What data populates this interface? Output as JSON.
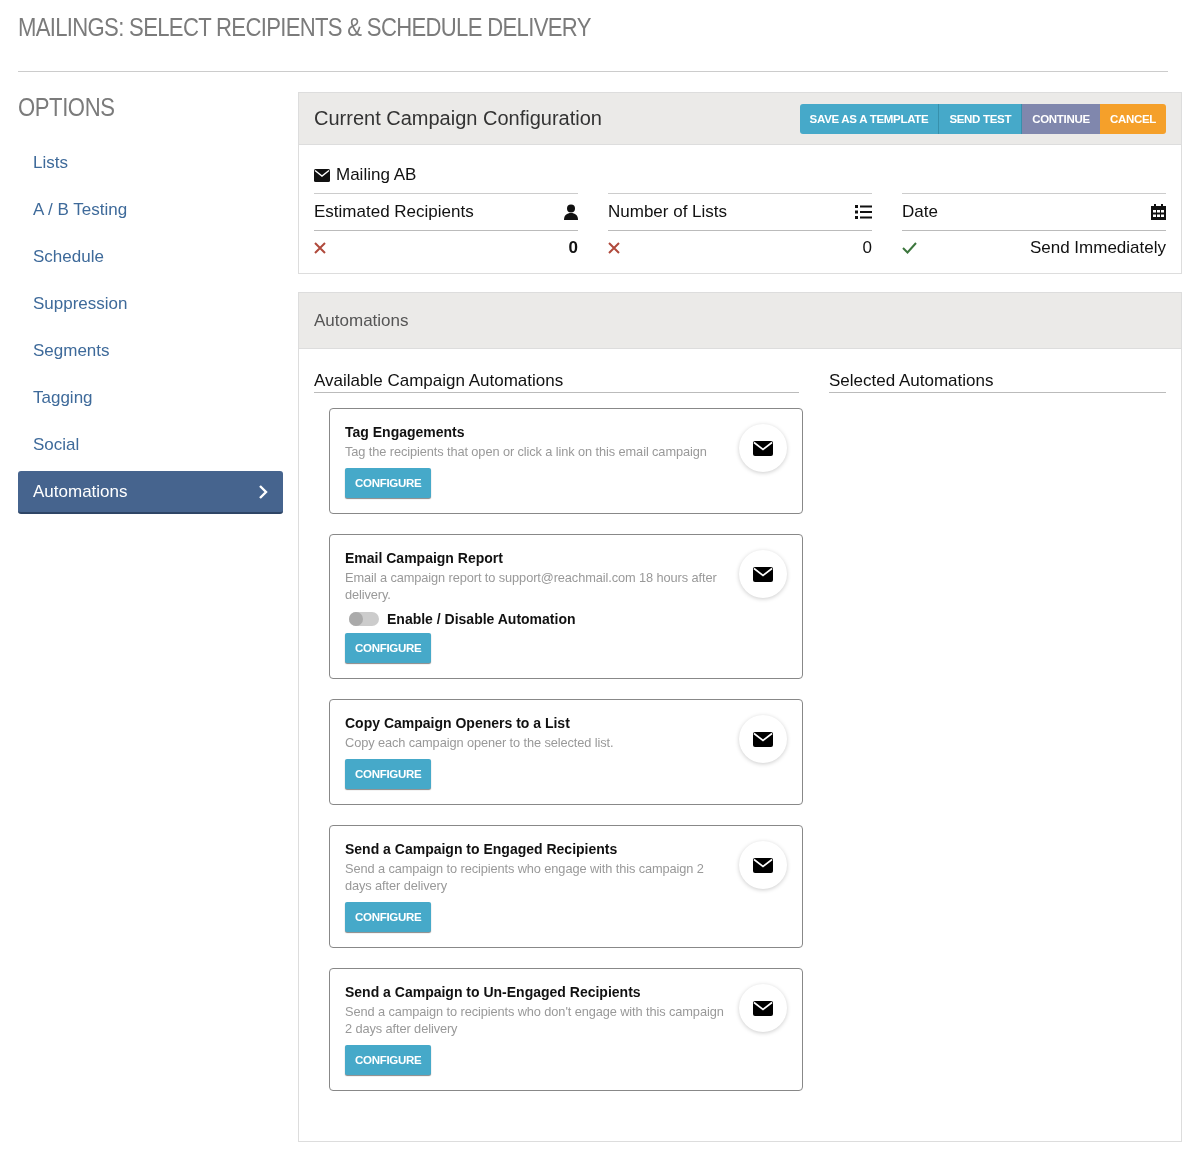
{
  "page_title": "MAILINGS: SELECT RECIPIENTS & SCHEDULE DELIVERY",
  "sidebar": {
    "title": "OPTIONS",
    "items": [
      {
        "label": "Lists",
        "selected": false
      },
      {
        "label": "A / B Testing",
        "selected": false
      },
      {
        "label": "Schedule",
        "selected": false
      },
      {
        "label": "Suppression",
        "selected": false
      },
      {
        "label": "Segments",
        "selected": false
      },
      {
        "label": "Tagging",
        "selected": false
      },
      {
        "label": "Social",
        "selected": false
      },
      {
        "label": "Automations",
        "selected": true
      }
    ]
  },
  "config": {
    "title": "Current Campaign Configuration",
    "buttons": [
      {
        "label": "SAVE AS A TEMPLATE",
        "kind": "info"
      },
      {
        "label": "SEND TEST",
        "kind": "info"
      },
      {
        "label": "CONTINUE",
        "kind": "muted"
      },
      {
        "label": "CANCEL",
        "kind": "warning"
      }
    ],
    "mailing_name": "Mailing AB",
    "stats": [
      {
        "label": "Estimated Recipients",
        "kind": "person",
        "ok": false,
        "value": "0",
        "bold": true
      },
      {
        "label": "Number of Lists",
        "kind": "list",
        "ok": false,
        "value": "0",
        "bold": false
      },
      {
        "label": "Date",
        "kind": "calendar",
        "ok": true,
        "value": "Send Immediately",
        "bold": false
      }
    ]
  },
  "automations": {
    "title": "Automations",
    "available_heading": "Available Campaign Automations",
    "selected_heading": "Selected Automations",
    "cards": [
      {
        "title": "Tag Engagements",
        "description": "Tag the recipients that open or click a link on this email campaign",
        "button": "CONFIGURE"
      },
      {
        "title": "Email Campaign Report",
        "description": "Email a campaign report to support@reachmail.com 18 hours after delivery.",
        "toggle": {
          "label": "Enable / Disable Automation",
          "on": false
        },
        "button": "CONFIGURE"
      },
      {
        "title": "Copy Campaign Openers to a List",
        "description": "Copy each campaign opener to the selected list.",
        "button": "CONFIGURE"
      },
      {
        "title": "Send a Campaign to Engaged Recipients",
        "description": "Send a campaign to recipients who engage with this campaign 2 days after delivery",
        "button": "CONFIGURE"
      },
      {
        "title": "Send a Campaign to Un-Engaged Recipients",
        "description": "Send a campaign to recipients who don't engage with this campaign 2 days after delivery",
        "button": "CONFIGURE"
      }
    ]
  }
}
